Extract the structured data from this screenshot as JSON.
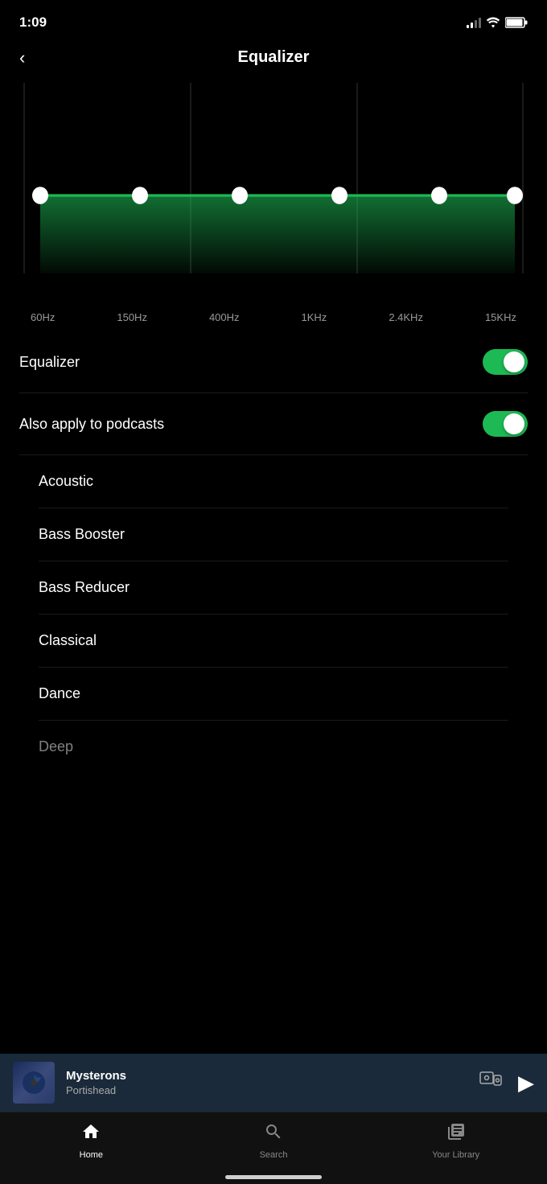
{
  "statusBar": {
    "time": "1:09"
  },
  "header": {
    "back_label": "<",
    "title": "Equalizer"
  },
  "equalizer": {
    "bands": [
      {
        "freq": "60Hz",
        "value": 0
      },
      {
        "freq": "150Hz",
        "value": 0
      },
      {
        "freq": "400Hz",
        "value": 0
      },
      {
        "freq": "1KHz",
        "value": 0
      },
      {
        "freq": "2.4KHz",
        "value": 0
      },
      {
        "freq": "15KHz",
        "value": 0
      }
    ]
  },
  "settings": {
    "equalizer_toggle_label": "Equalizer",
    "podcast_toggle_label": "Also apply to podcasts"
  },
  "presets": [
    {
      "name": "Acoustic"
    },
    {
      "name": "Bass Booster"
    },
    {
      "name": "Bass Reducer"
    },
    {
      "name": "Classical"
    },
    {
      "name": "Dance"
    },
    {
      "name": "Deep"
    }
  ],
  "nowPlaying": {
    "track": "Mysterons",
    "artist": "Portishead"
  },
  "bottomNav": {
    "items": [
      {
        "label": "Home",
        "icon": "home",
        "active": true
      },
      {
        "label": "Search",
        "icon": "search",
        "active": false
      },
      {
        "label": "Your Library",
        "icon": "library",
        "active": false
      }
    ]
  }
}
